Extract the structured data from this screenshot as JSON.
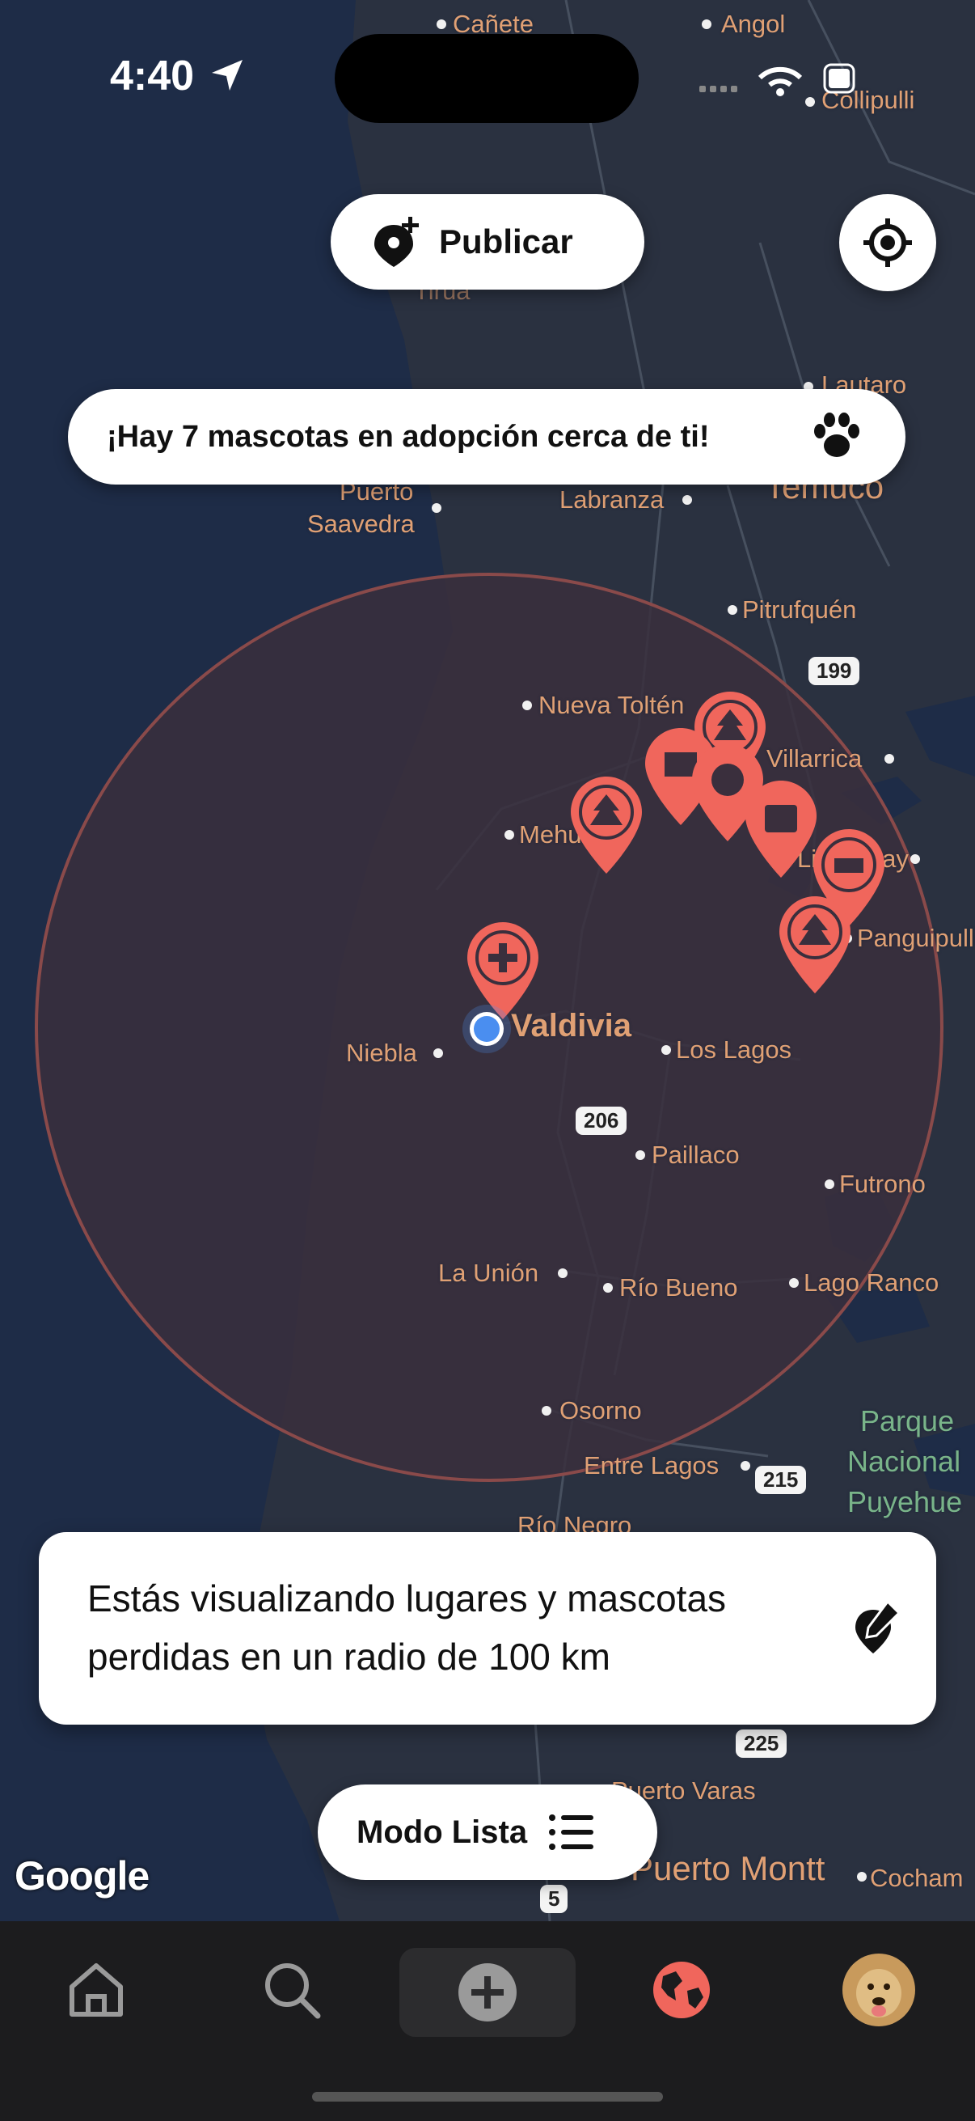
{
  "status_bar": {
    "time": "4:40"
  },
  "header": {
    "publish_label": "Publicar"
  },
  "banner": {
    "text": "¡Hay 7 mascotas en adopción cerca de ti!"
  },
  "map": {
    "places": {
      "canete": "Cañete",
      "angol": "Angol",
      "collipulli": "Collipulli",
      "tirua": "Tirúa",
      "lautaro": "Lautaro",
      "puerto": "Puerto",
      "saavedra": "Saavedra",
      "labranza": "Labranza",
      "temuco": "Temuco",
      "pitrufquen": "Pitrufquén",
      "nueva_tolten": "Nueva Toltén",
      "villarrica": "Villarrica",
      "mehuin": "Mehuín",
      "lican_ray": "Licán Ray",
      "panguipulli": "Panguipulli",
      "valdivia": "Valdivia",
      "niebla": "Niebla",
      "los_lagos": "Los Lagos",
      "paillaco": "Paillaco",
      "futrono": "Futrono",
      "la_union": "La Unión",
      "rio_bueno": "Río Bueno",
      "lago_ranco": "Lago Ranco",
      "osorno": "Osorno",
      "entre_lagos": "Entre Lagos",
      "parque1": "Parque",
      "parque2": "Nacional",
      "parque3": "Puyehue",
      "rio_negro": "Río Negro",
      "puerto_varas": "Puerto Varas",
      "puerto_montt": "Puerto Montt",
      "cochamo": "Cocham"
    },
    "routes": {
      "r199": "199",
      "r206": "206",
      "r215": "215",
      "r225": "225",
      "r5": "5"
    },
    "attribution": "Google",
    "colors": {
      "marker": "#f0665c",
      "user_dot": "#4a8ef0",
      "radius_fill": "#3a2f3d"
    }
  },
  "info_card": {
    "text": "Estás visualizando lugares y mascotas perdidas en un radio de 100 km"
  },
  "list_mode": {
    "label": "Modo Lista"
  },
  "tabs": [
    {
      "icon": "home-icon"
    },
    {
      "icon": "search-icon"
    },
    {
      "icon": "plus-icon"
    },
    {
      "icon": "globe-icon"
    },
    {
      "icon": "profile-avatar"
    }
  ]
}
